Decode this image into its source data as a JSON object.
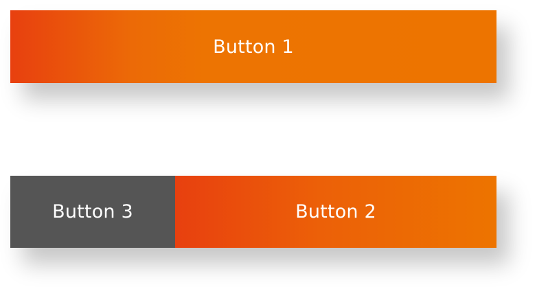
{
  "buttons": {
    "button1": {
      "label": "Button 1"
    },
    "button2": {
      "label": "Button 2"
    },
    "button3": {
      "label": "Button 3"
    }
  },
  "colors": {
    "gradient_start": "#e8400f",
    "gradient_end": "#ed7400",
    "dark_button": "#555555",
    "text": "#ffffff"
  }
}
